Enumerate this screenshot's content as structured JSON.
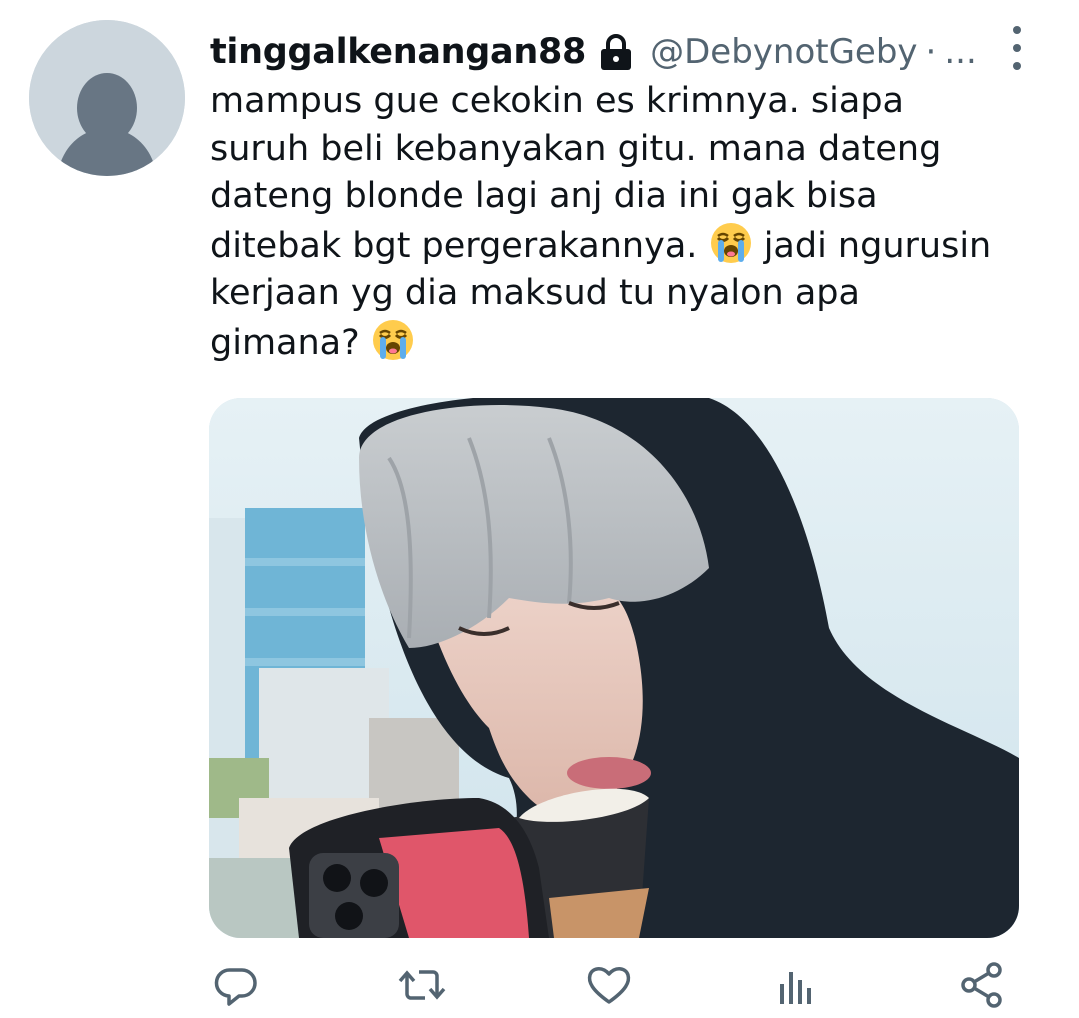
{
  "tweet": {
    "avatar_icon": "default-profile-avatar",
    "display_name": "tinggalkenangan88",
    "lock_icon": "lock-icon",
    "handle": "@DebynotGeby",
    "separator": "·",
    "time": "...",
    "text_lines": [
      "mampus gue cekokin es krimnya. siapa",
      "suruh beli kebanyakan gitu. mana dateng",
      "dateng blonde lagi anj dia ini gak bisa",
      "ditebak bgt pergerakannya.",
      "jadi ngurusin",
      "kerjaan yg dia maksud tu nyalon apa",
      "gimana?"
    ],
    "emoji": "loudly-crying-face",
    "media_description_icon": "photo",
    "actions": [
      "reply-icon",
      "retweet-icon",
      "like-icon",
      "analytics-icon",
      "share-icon"
    ]
  },
  "colors": {
    "text": "#0f1419",
    "secondary": "#536471",
    "avatar_bg": "#ccd6dd",
    "avatar_fg": "#687684"
  }
}
